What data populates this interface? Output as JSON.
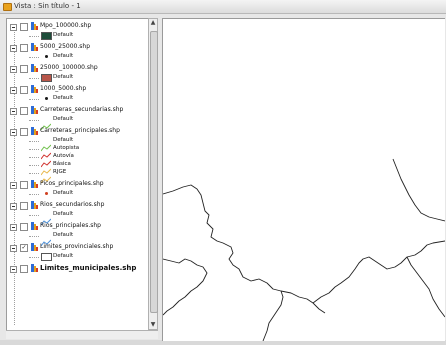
{
  "window": {
    "title": "Vista : Sin título - 1"
  },
  "toc": {
    "layers": [
      {
        "name": "Mpo_100000.shp",
        "checked": false,
        "symbol": "fill",
        "color": "#1e4d3a",
        "default_label": "Default"
      },
      {
        "name": "5000_25000.shp",
        "checked": false,
        "symbol": "point",
        "color": "#1a1a1a",
        "default_label": "Default"
      },
      {
        "name": "25000_100000.shp",
        "checked": false,
        "symbol": "fill",
        "color": "#b8564a",
        "default_label": "Default"
      },
      {
        "name": "1000_5000.shp",
        "checked": false,
        "symbol": "point",
        "color": "#1a1a1a",
        "default_label": "Default"
      },
      {
        "name": "Carreteras_secundarias.shp",
        "checked": false,
        "symbol": "line",
        "color": "#6fc04a",
        "default_label": "Default"
      },
      {
        "name": "Carreteras_principales.shp",
        "checked": false,
        "symbol": "lines",
        "items": [
          {
            "label": "Default",
            "color": "#6fc04a"
          },
          {
            "label": "Autopista",
            "color": "#d0312d"
          },
          {
            "label": "Autovía",
            "color": "#d0312d"
          },
          {
            "label": "Básica",
            "color": "#e8b84a"
          },
          {
            "label": "RJGE",
            "color": "#e8b84a"
          }
        ]
      },
      {
        "name": "Picos_principales.shp",
        "checked": false,
        "symbol": "point",
        "color": "#d04020",
        "default_label": "Default"
      },
      {
        "name": "Rios_secundarios.shp",
        "checked": false,
        "symbol": "line",
        "color": "#4a8fd8",
        "default_label": "Default"
      },
      {
        "name": "Rios_principales.shp",
        "checked": false,
        "symbol": "line",
        "color": "#4a8fd8",
        "default_label": "Default"
      },
      {
        "name": "Limites_provinciales.shp",
        "checked": true,
        "symbol": "hollow",
        "color": "#ffffff",
        "default_label": "Default"
      },
      {
        "name": "Limites_municipales.shp",
        "checked": false,
        "symbol": "none",
        "bold": true
      }
    ]
  },
  "colors": {
    "accent": "#2e6bd6",
    "title_icon": "#e9a21c"
  }
}
